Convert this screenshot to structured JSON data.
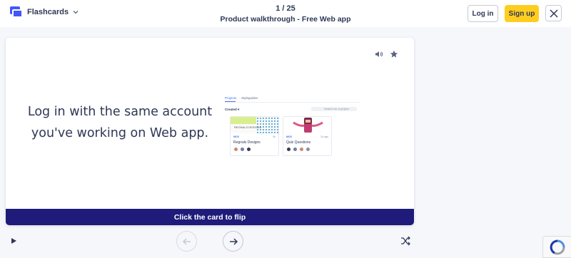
{
  "header": {
    "brand_label": "Flashcards",
    "counter": "1 / 25",
    "title": "Product walkthrough - Free Web app",
    "login_label": "Log in",
    "signup_label": "Sign up"
  },
  "card": {
    "front_text": "Log in with the same account you've working on Web app.",
    "flip_label": "Click the card to flip",
    "preview": {
      "tabs": [
        "Projects",
        "Styleguides"
      ],
      "filter_label": "Created",
      "search_placeholder": "Search for a project",
      "projects": [
        {
          "type": "MOS",
          "name": "Regnals Designs",
          "thumb_text": "REGNALS DESIGNS",
          "meta": "3h"
        },
        {
          "type": "MOS",
          "name": "Quiz Questions",
          "meta": "2h ago"
        }
      ]
    }
  },
  "colors": {
    "brand": "#4255ff",
    "signup": "#ffcd1f",
    "flip_bar": "#1e1b7a",
    "text": "#2e3856"
  },
  "icons": [
    "flashcards-logo-icon",
    "chevron-down-icon",
    "close-icon",
    "audio-icon",
    "star-icon",
    "play-icon",
    "arrow-left-icon",
    "arrow-right-icon",
    "shuffle-icon",
    "recaptcha-icon"
  ]
}
